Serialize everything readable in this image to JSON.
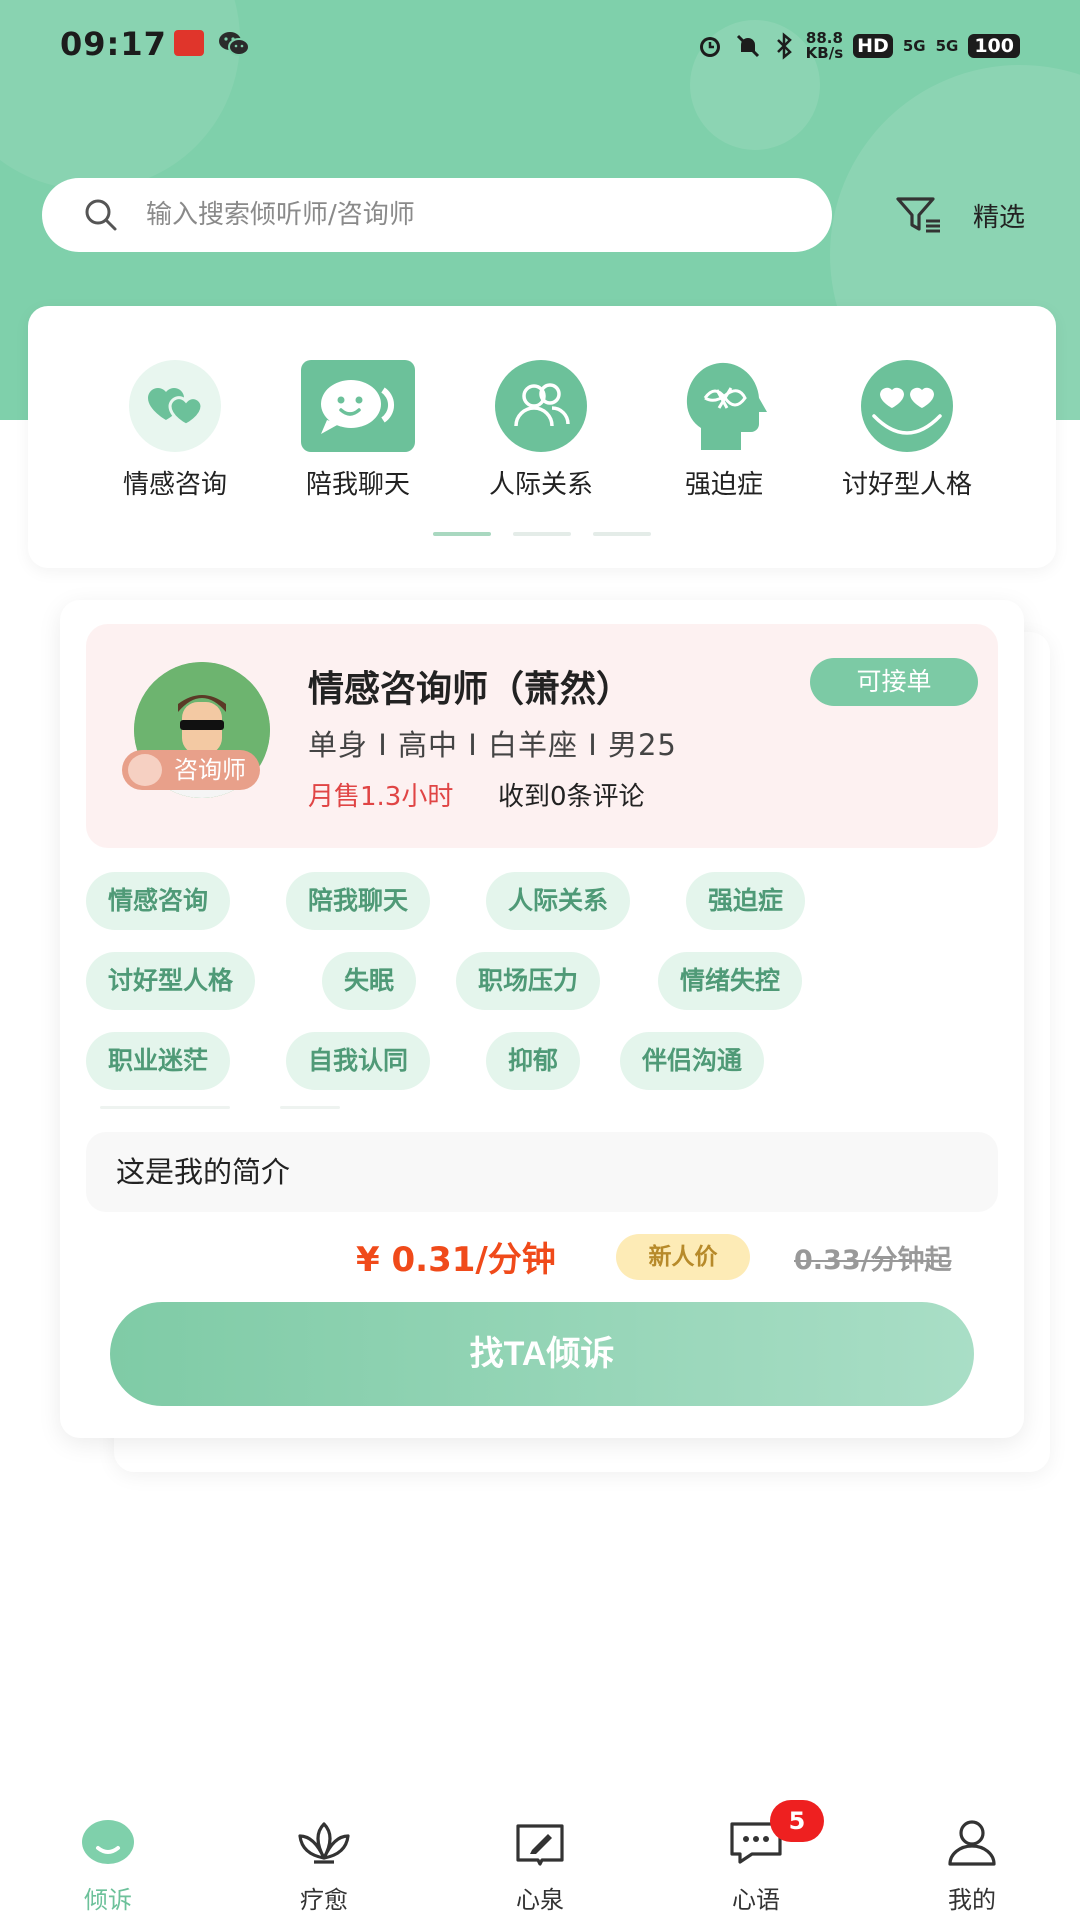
{
  "status_bar": {
    "time": "09:17",
    "net_speed_value": "88.8",
    "net_speed_unit": "KB/s",
    "hd": "HD",
    "signal1": "5G",
    "signal2": "5G",
    "battery": "100"
  },
  "search": {
    "placeholder": "输入搜索倾听师/咨询师",
    "filter_label": "精选"
  },
  "categories": [
    {
      "label": "情感咨询",
      "icon": "hearts-icon"
    },
    {
      "label": "陪我聊天",
      "icon": "chat-smile-icon"
    },
    {
      "label": "人际关系",
      "icon": "people-icon"
    },
    {
      "label": "强迫症",
      "icon": "head-tangle-icon"
    },
    {
      "label": "讨好型人格",
      "icon": "heart-eyes-face-icon"
    }
  ],
  "counselor": {
    "name": "情感咨询师（萧然）",
    "status": "可接单",
    "role_tag": "咨询师",
    "attributes": "单身 I 高中 I 白羊座 I 男25",
    "monthly_sales": "月售1.3小时",
    "reviews": "收到0条评论",
    "tags": [
      "情感咨询",
      "陪我聊天",
      "人际关系",
      "强迫症",
      "讨好型人格",
      "失眠",
      "职场压力",
      "情绪失控",
      "职业迷茫",
      "自我认同",
      "抑郁",
      "伴侣沟通"
    ],
    "intro": "这是我的简介",
    "price": "¥ 0.31/分钟",
    "price_badge": "新人价",
    "original_price": "0.33/分钟起",
    "cta": "找TA倾诉"
  },
  "nav": {
    "items": [
      {
        "label": "倾诉",
        "icon": "listen-icon"
      },
      {
        "label": "疗愈",
        "icon": "lotus-icon"
      },
      {
        "label": "心泉",
        "icon": "book-icon"
      },
      {
        "label": "心语",
        "icon": "message-icon",
        "badge": "5"
      },
      {
        "label": "我的",
        "icon": "profile-icon"
      }
    ]
  },
  "colors": {
    "brand_green": "#7fd0ab",
    "price_red": "#f04a1a",
    "badge_red": "#ee2020"
  }
}
